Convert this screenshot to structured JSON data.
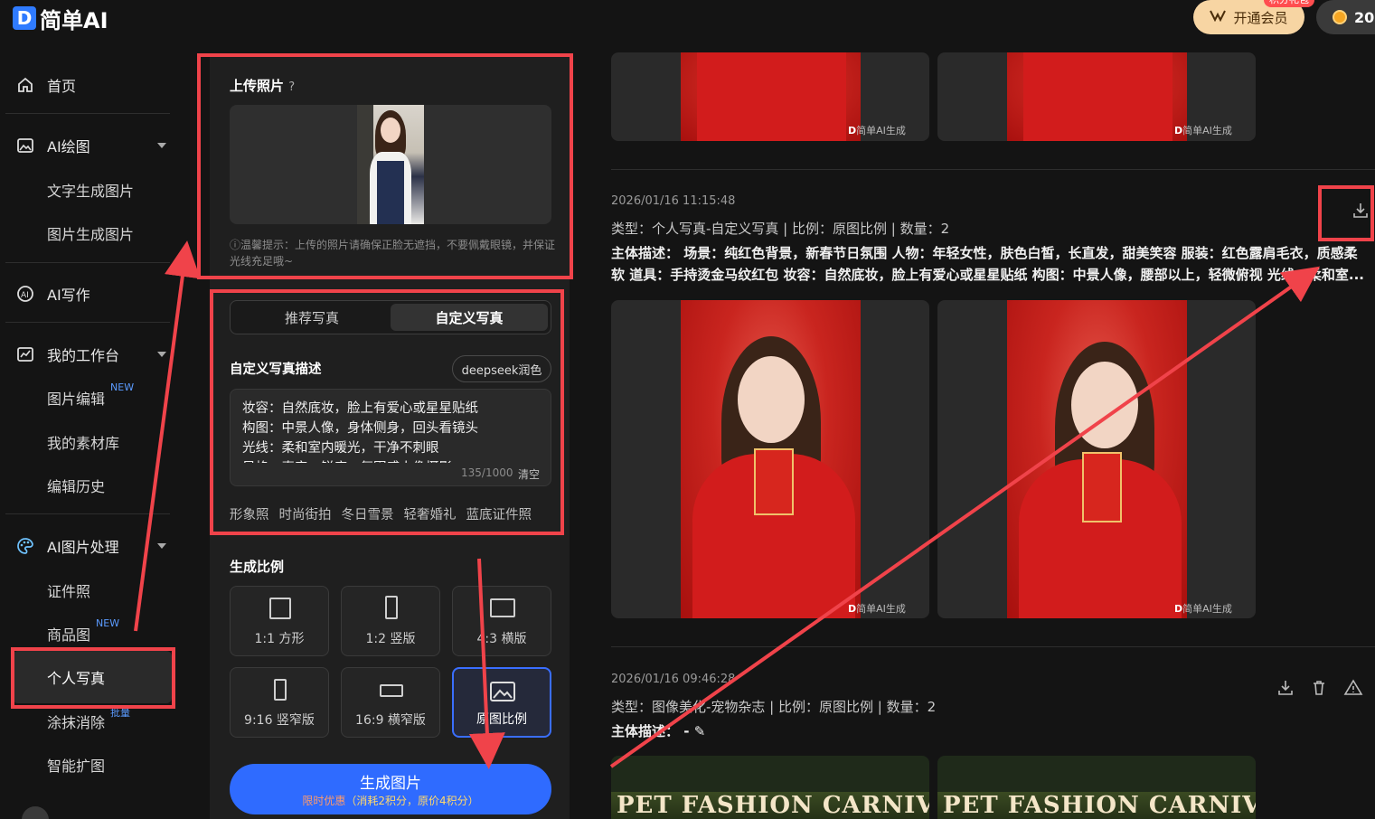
{
  "brand": {
    "logo_letter": "D",
    "name": "简单AI"
  },
  "header": {
    "vip_label": "开通会员",
    "vip_badge": "积分礼包",
    "coins": "20"
  },
  "nav": {
    "home": "首页",
    "ai_draw": "AI绘图",
    "text2img": "文字生成图片",
    "img2img": "图片生成图片",
    "ai_write": "AI写作",
    "workspace": "我的工作台",
    "img_edit": "图片编辑",
    "img_edit_badge": "NEW",
    "materials": "我的素材库",
    "history": "编辑历史",
    "img_proc": "AI图片处理",
    "id_photo": "证件照",
    "product": "商品图",
    "product_badge": "NEW",
    "portrait": "个人写真",
    "erase": "涂抹消除",
    "erase_badge": "批量",
    "expand": "智能扩图"
  },
  "upload": {
    "title": "上传照片",
    "hint": "ⓘ温馨提示：上传的照片请确保正脸无遮挡，不要佩戴眼镜，并保证光线充足哦~"
  },
  "tabs": [
    "推荐写真",
    "自定义写真"
  ],
  "custom": {
    "title": "自定义写真描述",
    "deepseek": "deepseek润色",
    "lines": [
      "妆容：自然底妆，脸上有爱心或星星贴纸",
      "构图：中景人像，身体侧身，回头看镜头",
      "光线：柔和室内暖光，干净不刺眼",
      "风格：真实，锐度，氛围感人像摄影"
    ],
    "count": "135/1000",
    "clear": "清空",
    "chips": [
      "形象照",
      "时尚街拍",
      "冬日雪景",
      "轻奢婚礼",
      "蓝底证件照"
    ]
  },
  "ratio": {
    "title": "生成比例",
    "options": [
      {
        "label": "1:1 方形"
      },
      {
        "label": "1:2 竖版"
      },
      {
        "label": "4:3 横版"
      },
      {
        "label": "9:16 竖窄版"
      },
      {
        "label": "16:9 横窄版"
      },
      {
        "label": "原图比例"
      }
    ],
    "selected": "原图比例"
  },
  "generate": {
    "label": "生成图片",
    "promo": "限时优惠",
    "sub": "（消耗2积分，原价4积分）"
  },
  "results": [
    {
      "watermark": "简单AI生成"
    },
    {
      "time": "2026/01/16 11:15:48",
      "type": "类型：个人写真-自定义写真 | 比例：原图比例 | 数量：2",
      "desc1": "主体描述： 场景：纯红色背景，新春节日氛围 人物：年轻女性，肤色白皙，长直发，甜美笑容 服装：红色露肩毛衣，质感柔",
      "desc2": "软 道具：手持烫金马纹红包 妆容：自然底妆，脸上有爱心或星星贴纸 构图：中景人像，腰部以上，轻微俯视 光线：柔和室...",
      "watermark": "简单AI生成"
    },
    {
      "time": "2026/01/16 09:46:28",
      "type": "类型：图像美化-宠物杂志 | 比例：原图比例 | 数量：2",
      "desc": "主体描述：  -",
      "banner": "PET FASHION CARNIVAL"
    }
  ]
}
